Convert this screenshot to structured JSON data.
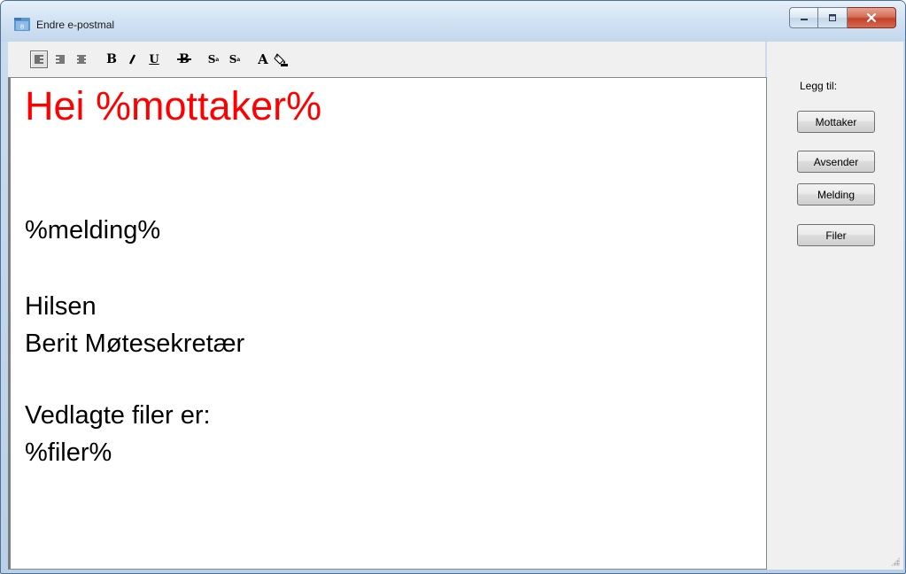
{
  "window": {
    "title": "Endre e-postmal"
  },
  "toolbar": {
    "buttons": [
      {
        "name": "align-left-icon",
        "active": true
      },
      {
        "name": "align-right-icon",
        "active": false
      },
      {
        "name": "align-center-icon",
        "active": false
      },
      {
        "name": "bold-icon",
        "glyph": "B"
      },
      {
        "name": "italic-icon",
        "glyph": "I"
      },
      {
        "name": "underline-icon",
        "glyph": "U"
      },
      {
        "name": "strikethrough-icon",
        "glyph": "B"
      },
      {
        "name": "superscript-icon",
        "glyph": "S"
      },
      {
        "name": "subscript-icon",
        "glyph": "S"
      },
      {
        "name": "font-icon",
        "glyph": "A"
      },
      {
        "name": "fill-color-icon"
      }
    ]
  },
  "editor": {
    "heading": "Hei %mottaker%",
    "heading_color": "#ff0000",
    "lines": [
      "%melding%",
      "Hilsen",
      "Berit Møtesekretær",
      "Vedlagte filer er:",
      "%filer%"
    ]
  },
  "sidepanel": {
    "label": "Legg til:",
    "buttons": [
      "Mottaker",
      "Avsender",
      "Melding",
      "Filer"
    ]
  }
}
